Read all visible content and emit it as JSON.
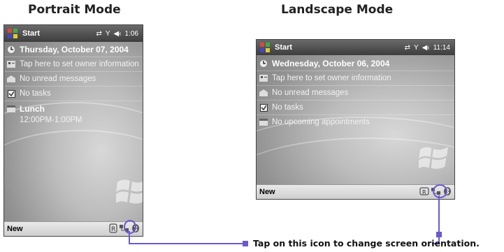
{
  "headings": {
    "portrait": "Portrait Mode",
    "landscape": "Landscape Mode"
  },
  "portrait": {
    "start": "Start",
    "time": "1:06",
    "date": "Thursday, October 07, 2004",
    "owner": "Tap here to set owner information",
    "messages": "No unread messages",
    "tasks": "No tasks",
    "appointment_title": "Lunch",
    "appointment_time": "12:00PM-1:00PM",
    "new_label": "New"
  },
  "landscape": {
    "start": "Start",
    "time": "11:14",
    "date": "Wednesday, October 06, 2004",
    "owner": "Tap here to set owner information",
    "messages": "No unread messages",
    "tasks": "No tasks",
    "appointments": "No upcoming appointments",
    "new_label": "New"
  },
  "callout": "Tap on this icon to change screen orientation.",
  "colors": {
    "accent": "#6a5acd"
  },
  "icons": [
    "windows-flag-icon",
    "sync-icon",
    "signal-icon",
    "speaker-icon",
    "calendar-icon",
    "contact-card-icon",
    "inbox-icon",
    "checkbox-icon",
    "appointment-icon",
    "orientation-icon",
    "connection-icon",
    "bluetooth-icon"
  ]
}
